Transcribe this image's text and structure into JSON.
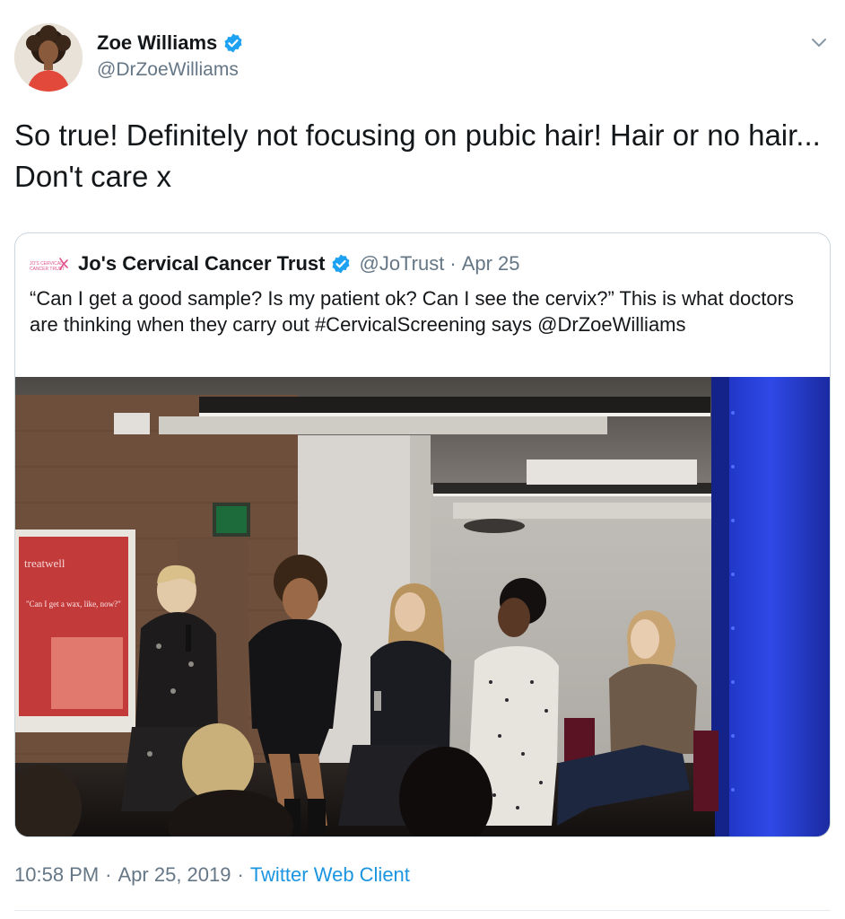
{
  "author": {
    "name": "Zoe Williams",
    "handle": "@DrZoeWilliams",
    "verified_icon": "verified-badge-icon",
    "avatar_icon": "avatar"
  },
  "tweet": {
    "text": "So true! Definitely not focusing on pubic hair! Hair or no hair... Don't care x"
  },
  "quoted": {
    "name": "Jo's Cervical Cancer Trust",
    "handle": "@JoTrust",
    "separator": "·",
    "date": "Apr 25",
    "text": "“Can I get a good sample? Is my patient ok? Can I see the cervix?” This is what doctors are thinking when they carry out #CervicalScreening says @DrZoeWilliams",
    "media_sign_brand": "treatwell",
    "media_sign_quote": "\"Can I get a wax, like, now?\""
  },
  "footer": {
    "time": "10:58 PM",
    "sep1": "·",
    "date": "Apr 25, 2019",
    "sep2": "·",
    "client": "Twitter Web Client"
  },
  "colors": {
    "accent": "#1b95e0",
    "verified": "#1da1f2",
    "muted": "#657786",
    "text": "#14171a",
    "border": "#ccd6dd"
  }
}
